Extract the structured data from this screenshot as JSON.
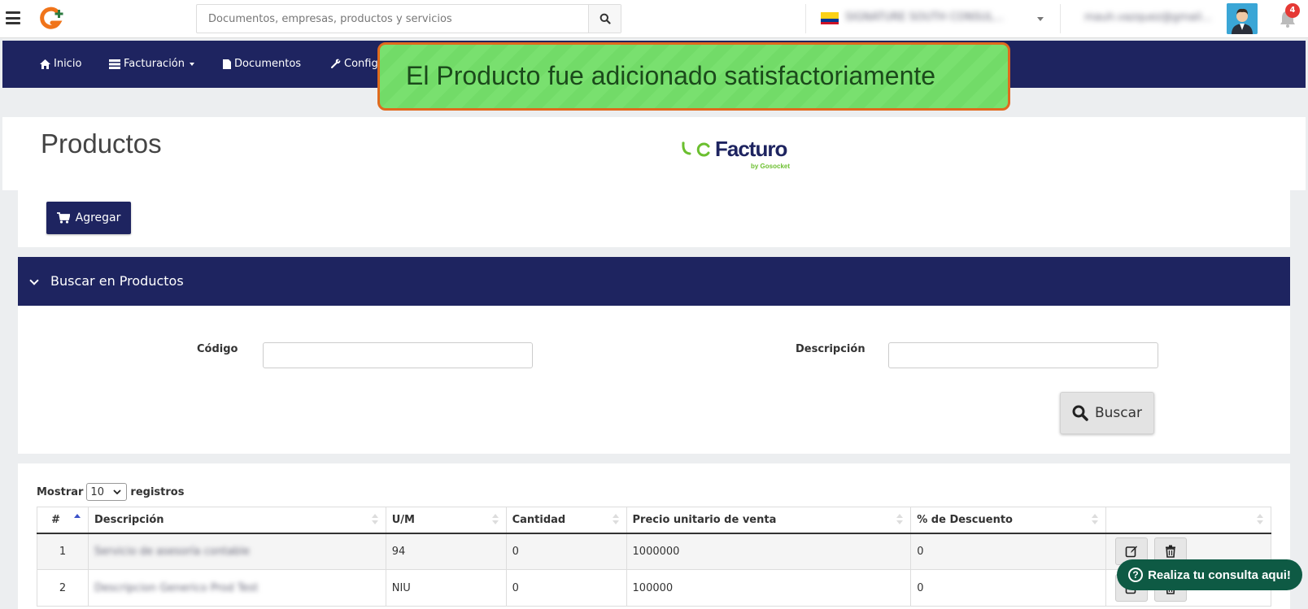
{
  "topbar": {
    "search_placeholder": "Documentos, empresas, productos y servicios",
    "company_name": "SIGNATURE SOUTH CONSUL...",
    "user_email": "mauh.vazquez@gmail...",
    "notification_count": "4"
  },
  "nav": {
    "items": [
      {
        "label": "Inicio",
        "icon": "home-icon"
      },
      {
        "label": "Facturación",
        "icon": "list-icon"
      },
      {
        "label": "Documentos",
        "icon": "file-icon"
      },
      {
        "label": "Config",
        "icon": "wrench-icon"
      }
    ]
  },
  "toast": {
    "message": "El Producto fue adicionado satisfactoriamente"
  },
  "page": {
    "title": "Productos"
  },
  "brand": {
    "name": "Facturo",
    "tagline": "by Gosocket"
  },
  "actions": {
    "add_label": "Agregar"
  },
  "search_panel": {
    "title": "Buscar en Productos",
    "code_label": "Código",
    "description_label": "Descripción",
    "search_button": "Buscar"
  },
  "table": {
    "length_prefix": "Mostrar",
    "length_value": "10",
    "length_suffix": "registros",
    "columns": [
      "#",
      "Descripción",
      "U/M",
      "Cantidad",
      "Precio unitario de venta",
      "% de Descuento",
      ""
    ],
    "rows": [
      {
        "n": "1",
        "description": "Servicio de asesoría contable",
        "um": "94",
        "quantity": "0",
        "price": "1000000",
        "discount": "0"
      },
      {
        "n": "2",
        "description": "Descripcion Generico Prod Test",
        "um": "NIU",
        "quantity": "0",
        "price": "100000",
        "discount": "0"
      }
    ]
  },
  "help": {
    "label": "Realiza tu consulta aqui!"
  },
  "colors": {
    "navy": "#1e2460",
    "toast_green": "#79e06f",
    "toast_border": "#e06a1e",
    "help_green": "#0e5a44",
    "badge_red": "#e53935"
  }
}
